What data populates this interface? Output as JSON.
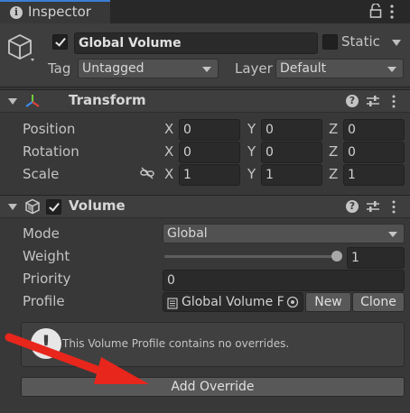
{
  "tab": {
    "title": "Inspector"
  },
  "object": {
    "name": "Global Volume",
    "static_label": "Static",
    "tag_label": "Tag",
    "tag_value": "Untagged",
    "layer_label": "Layer",
    "layer_value": "Default"
  },
  "transform": {
    "title": "Transform",
    "rows": [
      {
        "label": "Position",
        "x": "0",
        "y": "0",
        "z": "0"
      },
      {
        "label": "Rotation",
        "x": "0",
        "y": "0",
        "z": "0"
      },
      {
        "label": "Scale",
        "x": "1",
        "y": "1",
        "z": "1"
      }
    ],
    "axis_x": "X",
    "axis_y": "Y",
    "axis_z": "Z"
  },
  "volume": {
    "title": "Volume",
    "mode_label": "Mode",
    "mode_value": "Global",
    "weight_label": "Weight",
    "weight_value": "1",
    "weight_fraction": 1.0,
    "priority_label": "Priority",
    "priority_value": "0",
    "profile_label": "Profile",
    "profile_value": "Global Volume F",
    "new_button": "New",
    "clone_button": "Clone",
    "help_message": "This Volume Profile contains no overrides.",
    "add_override_button": "Add Override"
  },
  "colors": {
    "annotation_arrow": "#e8261c",
    "panel_bg": "#383838",
    "header_bg": "#3e3e3e"
  },
  "icons": [
    "info-icon",
    "lock-icon",
    "kebab-menu-icon",
    "gameobject-cube-icon",
    "transform-axes-icon",
    "help-icon",
    "preset-sliders-icon",
    "link-icon",
    "volume-cube-icon",
    "object-picker-icon",
    "warning-icon"
  ]
}
